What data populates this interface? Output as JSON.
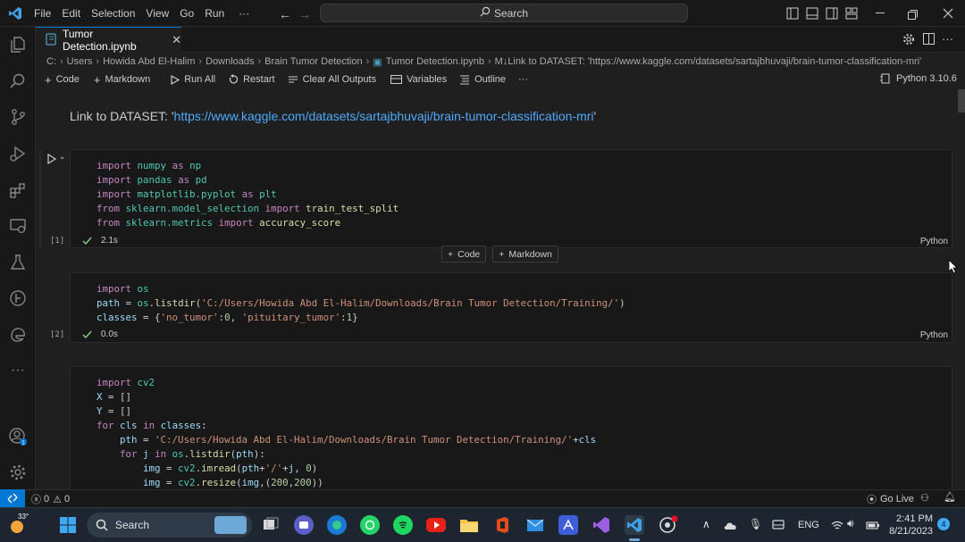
{
  "titlebar": {
    "menus": [
      "File",
      "Edit",
      "Selection",
      "View",
      "Go",
      "Run",
      "···"
    ],
    "search_label": "Search"
  },
  "tab": {
    "label": "Tumor Detection.ipynb"
  },
  "breadcrumb": [
    "C:",
    "Users",
    "Howida Abd El-Halim",
    "Downloads",
    "Brain Tumor Detection",
    "Tumor Detection.ipynb",
    "M↓Link to DATASET: 'https://www.kaggle.com/datasets/sartajbhuvaji/brain-tumor-classification-mri'"
  ],
  "toolbar": {
    "code": "Code",
    "markdown": "Markdown",
    "run_all": "Run All",
    "restart": "Restart",
    "clear_outputs": "Clear All Outputs",
    "variables": "Variables",
    "outline": "Outline",
    "more": "···",
    "kernel": "Python 3.10.6"
  },
  "markdown_cell": {
    "prefix": "Link to DATASET: '",
    "link": "https://www.kaggle.com/datasets/sartajbhuvaji/brain-tumor-classification-mri",
    "suffix": "'"
  },
  "cells": [
    {
      "count": "[1]",
      "time": "2.1s",
      "lang": "Python"
    },
    {
      "count": "[2]",
      "time": "0.0s",
      "lang": "Python"
    }
  ],
  "insert_bar": {
    "code": "Code",
    "markdown": "Markdown"
  },
  "statusbar": {
    "errors": "0",
    "warnings": "0",
    "go_live": "Go Live"
  },
  "taskbar": {
    "weather": "33°",
    "search": "Search",
    "lang": "ENG",
    "time": "2:41 PM",
    "date": "8/21/2023",
    "notif_count": "4"
  },
  "colors": {
    "accent": "#0078d4",
    "link": "#4daafc",
    "ok": "#89d185"
  }
}
